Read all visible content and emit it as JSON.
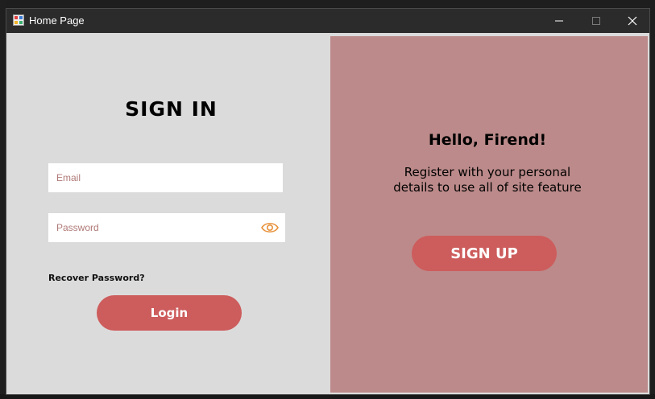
{
  "window": {
    "title": "Home Page",
    "minimize_glyph": "—",
    "maximize_glyph": "☐",
    "close_glyph": "✕"
  },
  "signin": {
    "title": "SIGN IN",
    "email_placeholder": "Email",
    "email_value": "",
    "password_placeholder": "Password",
    "password_value": "",
    "recover_label": "Recover Password?",
    "login_label": "Login"
  },
  "signup": {
    "greeting": "Hello, Firend!",
    "message_line1": "Register with your personal",
    "message_line2": "details to use all of site feature",
    "signup_label": "SIGN UP"
  },
  "icons": {
    "app": "app-window-icon",
    "eye": "eye-icon"
  },
  "colors": {
    "accent_button": "#cd5c5c",
    "left_panel": "#dcdbdb",
    "right_panel": "#bc8a8a",
    "eye_icon": "#e8913a",
    "placeholder": "#b07a78"
  }
}
